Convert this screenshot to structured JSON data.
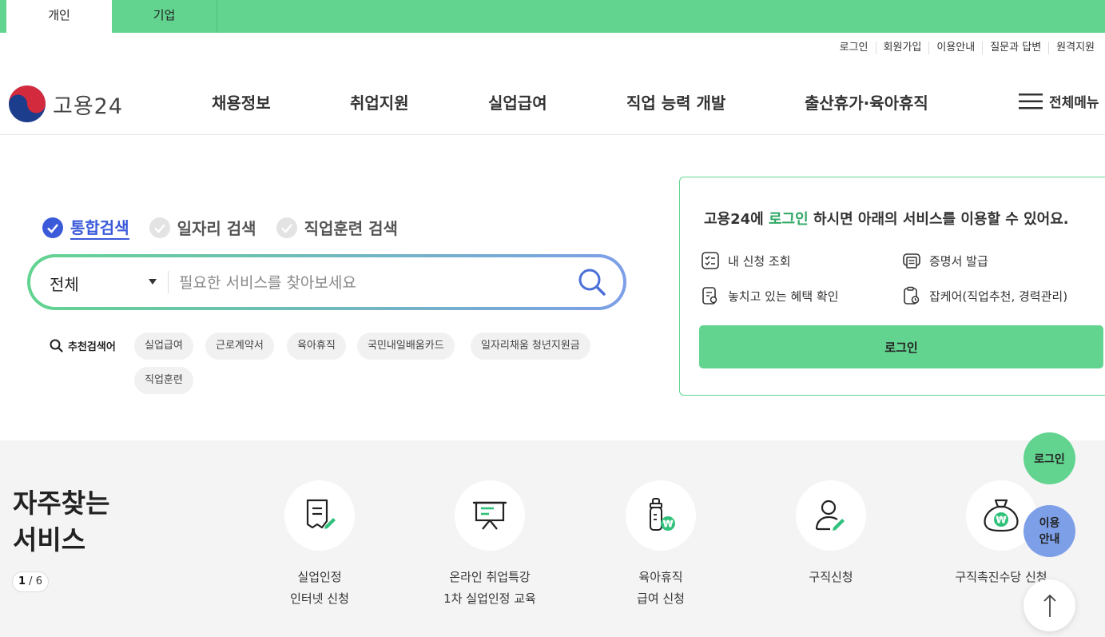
{
  "top_tabs": [
    "개인",
    "기업"
  ],
  "util_links": [
    "로그인",
    "회원가입",
    "이용안내",
    "질문과 답변",
    "원격지원"
  ],
  "logo_text": "고용24",
  "nav": [
    "채용정보",
    "취업지원",
    "실업급여",
    "직업 능력 개발",
    "출산휴가·육아휴직"
  ],
  "all_menu": "전체메뉴",
  "search_tabs": [
    "통합검색",
    "일자리 검색",
    "직업훈련 검색"
  ],
  "search": {
    "select_value": "전체",
    "placeholder": "필요한 서비스를 찾아보세요"
  },
  "recommend": {
    "label": "추천검색어",
    "keywords": [
      "실업급여",
      "근로계약서",
      "육아휴직",
      "국민내일배움카드",
      "일자리채움 청년지원금",
      "직업훈련"
    ]
  },
  "login_box": {
    "lead_before": "고용24에 ",
    "lead_highlight": "로그인",
    "lead_after": " 하시면 아래의 서비스를 이용할 수 있어요.",
    "services": [
      "내 신청 조회",
      "증명서 발급",
      "놓치고 있는 혜택 확인",
      "잡케어(직업추천, 경력관리)"
    ],
    "button": "로그인"
  },
  "frequent": {
    "title_line1": "자주찾는",
    "title_line2": "서비스",
    "pager_current": "1",
    "pager_total": "6",
    "items": [
      {
        "label": "실업인정\n인터넷 신청",
        "icon": "document-pen-icon"
      },
      {
        "label": "온라인 취업특강\n1차 실업인정 교육",
        "icon": "presentation-board-icon"
      },
      {
        "label": "육아휴직\n급여 신청",
        "icon": "baby-bottle-won-icon"
      },
      {
        "label": "구직신청",
        "icon": "person-pen-icon"
      },
      {
        "label": "구직촉진수당 신청",
        "icon": "money-bag-won-icon"
      }
    ]
  },
  "floating": {
    "login": "로그인",
    "guide": "이용\n안내"
  },
  "colors": {
    "brand_green": "#62d490",
    "brand_blue": "#7d9fe8",
    "active_blue": "#3a5ad9"
  }
}
